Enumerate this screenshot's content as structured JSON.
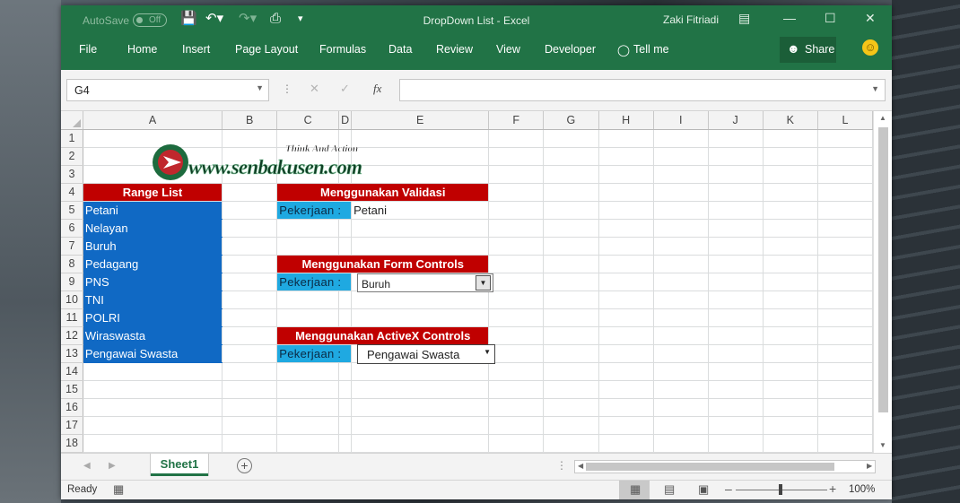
{
  "title": {
    "autosave_label": "AutoSave",
    "autosave_state": "Off",
    "window_title": "DropDown List  -  Excel",
    "user": "Zaki Fitriadi"
  },
  "menu": [
    "File",
    "Home",
    "Insert",
    "Page Layout",
    "Formulas",
    "Data",
    "Review",
    "View",
    "Developer",
    "Tell me"
  ],
  "share_label": "Share",
  "formula_bar": {
    "name_box": "G4",
    "fx": "fx",
    "formula": ""
  },
  "columns": [
    "A",
    "B",
    "C",
    "D",
    "E",
    "F",
    "G",
    "H",
    "I",
    "J",
    "K",
    "L"
  ],
  "rows": [
    "1",
    "2",
    "3",
    "4",
    "5",
    "6",
    "7",
    "8",
    "9",
    "10",
    "11",
    "12",
    "13",
    "14",
    "15",
    "16",
    "17",
    "18"
  ],
  "logo": {
    "site": "www.senbakusen.com",
    "tagline": "Think And Action"
  },
  "range_list": {
    "header": "Range List",
    "items": [
      "Petani",
      "Nelayan",
      "Buruh",
      "Pedagang",
      "PNS",
      "TNI",
      "POLRI",
      "Wiraswasta",
      "Pengawai Swasta"
    ]
  },
  "validasi": {
    "header": "Menggunakan Validasi",
    "label": "Pekerjaan  :",
    "value": "Petani"
  },
  "form_controls": {
    "header": "Menggunakan Form Controls",
    "label": "Pekerjaan  :",
    "value": "Buruh"
  },
  "activex": {
    "header": "Menggunakan ActiveX Controls",
    "label": "Pekerjaan  :",
    "value": "Pengawai Swasta"
  },
  "sheet_tab": "Sheet1",
  "status": {
    "ready": "Ready",
    "zoom": "100%"
  },
  "colors": {
    "excel_green": "#217346",
    "range_blue": "#1069c4",
    "header_red": "#c00000",
    "label_cyan": "#1fa9e1"
  }
}
